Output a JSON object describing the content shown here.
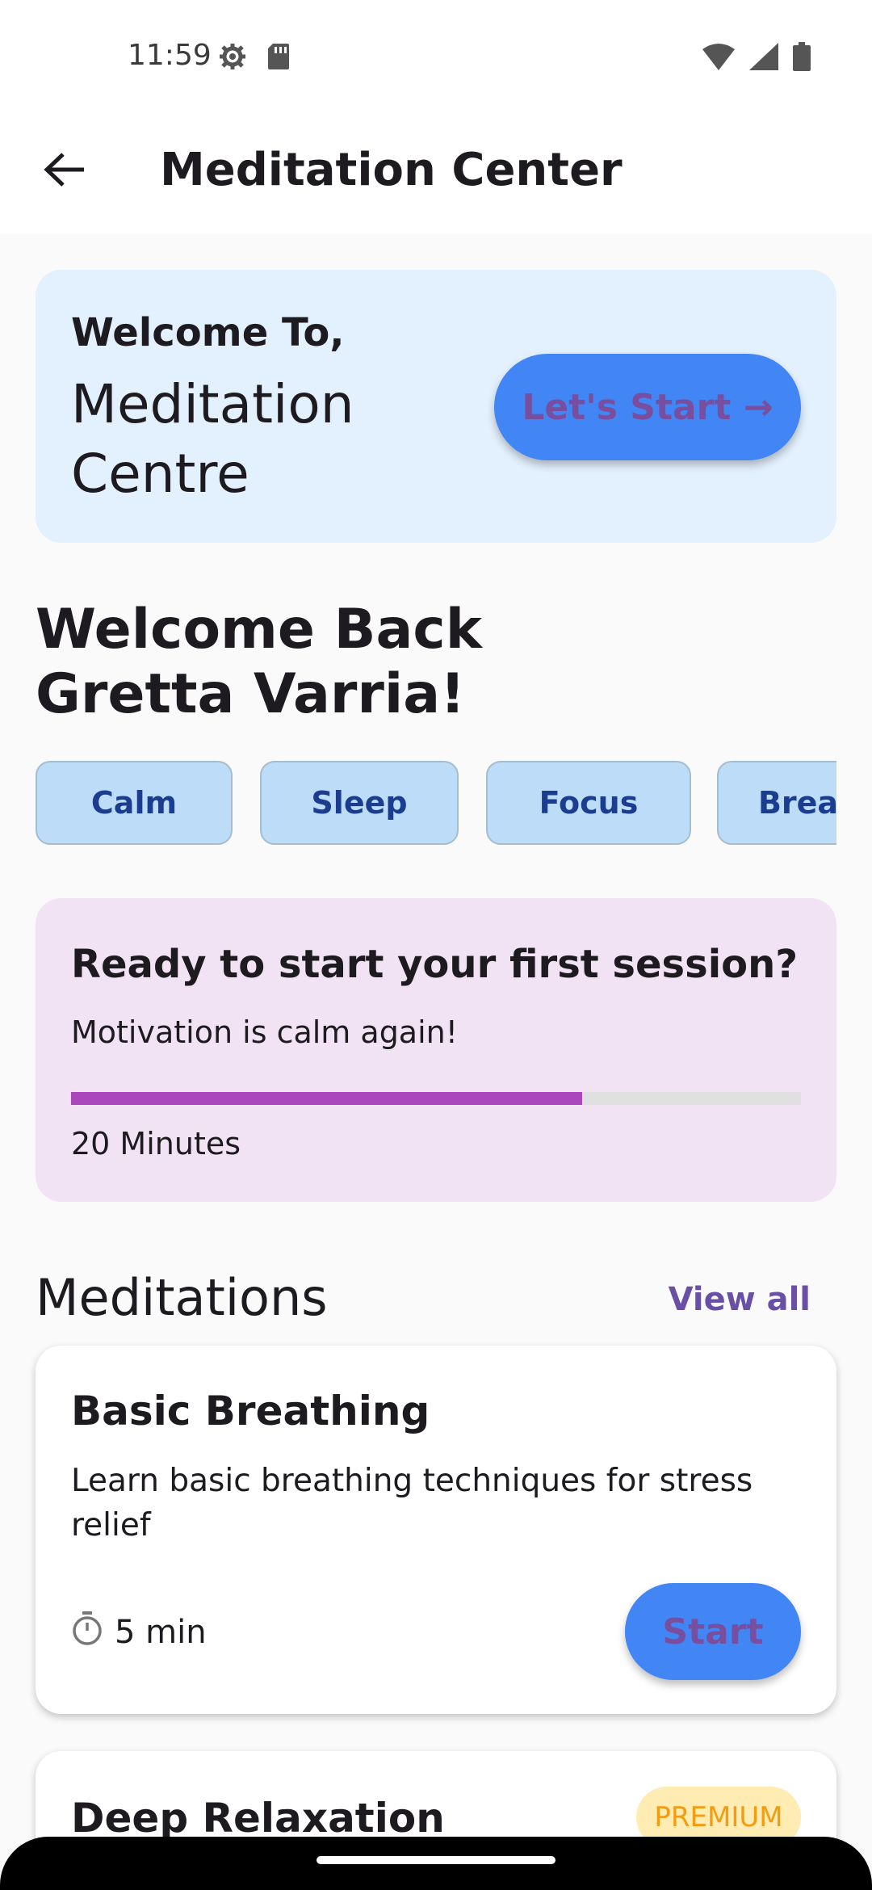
{
  "status_bar": {
    "time": "11:59",
    "icons_left": [
      "settings-icon",
      "sd-card-icon"
    ],
    "icons_right": [
      "wifi-icon",
      "signal-icon",
      "battery-icon"
    ]
  },
  "app_bar": {
    "title": "Meditation Center",
    "back_icon": "arrow-back-icon"
  },
  "hero": {
    "kicker": "Welcome To,",
    "title": "Meditation Centre",
    "button_label": "Let's Start →"
  },
  "welcome": {
    "line1": "Welcome Back",
    "line2": "Gretta Varria!"
  },
  "categories": {
    "items": [
      "Calm",
      "Sleep",
      "Focus",
      "Breathe"
    ]
  },
  "session": {
    "title": "Ready to start your first session?",
    "subtitle": "Motivation is calm again!",
    "progress": 0.7,
    "duration": "20 Minutes"
  },
  "meditations": {
    "section_title": "Meditations",
    "view_all": "View all",
    "items": [
      {
        "title": "Basic Breathing",
        "description": "Learn basic breathing techniques for stress relief",
        "duration": "5 min",
        "button_label": "Start"
      },
      {
        "title": "Deep Relaxation",
        "badge": "PREMIUM"
      }
    ]
  },
  "colors": {
    "primary_button": "#4285f4",
    "hero_bg": "#e3f0fd",
    "session_bg": "#f2e3f4",
    "progress_fill": "#ab47bc",
    "chip_bg": "#bcdcf8",
    "premium_text": "#f39c12"
  }
}
